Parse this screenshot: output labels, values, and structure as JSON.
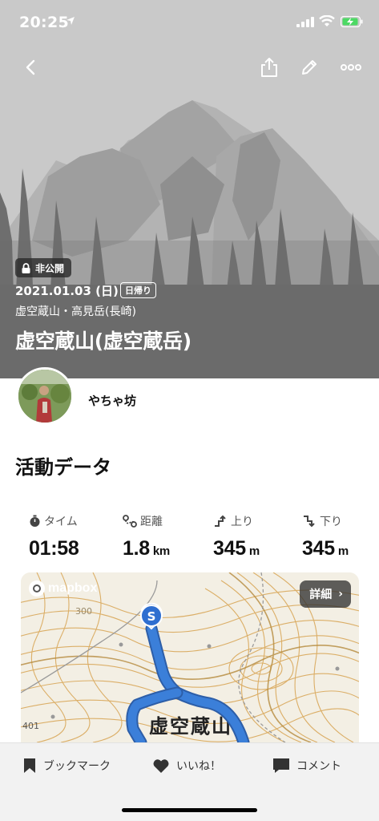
{
  "status_bar": {
    "time": "20:25"
  },
  "hero": {
    "privacy_label": "非公開",
    "date": "2021.01.03 (日)",
    "trip_type": "日帰り",
    "area": "虚空蔵山・高見岳(長崎)",
    "title": "虚空蔵山(虚空蔵岳)"
  },
  "user": {
    "name": "やちゃ坊"
  },
  "activity": {
    "section_title": "活動データ",
    "stats": [
      {
        "label": "タイム",
        "value": "01:58",
        "unit": "",
        "icon": "stopwatch-icon"
      },
      {
        "label": "距離",
        "value": "1.8",
        "unit": "km",
        "icon": "route-distance-icon"
      },
      {
        "label": "上り",
        "value": "345",
        "unit": "m",
        "icon": "ascent-icon"
      },
      {
        "label": "下り",
        "value": "345",
        "unit": "m",
        "icon": "descent-icon"
      }
    ]
  },
  "map": {
    "provider": "mapbox",
    "detail_label": "詳細",
    "start_marker": "S",
    "place_label": "虚空蔵山",
    "contour_labels": [
      "300",
      "401"
    ]
  },
  "bottom_bar": {
    "bookmark": "ブックマーク",
    "like": "いいね！",
    "comment": "コメント"
  },
  "colors": {
    "route": "#3b7fd9",
    "contour": "#d6a04a",
    "hero_bg": "#c7c7c7"
  }
}
